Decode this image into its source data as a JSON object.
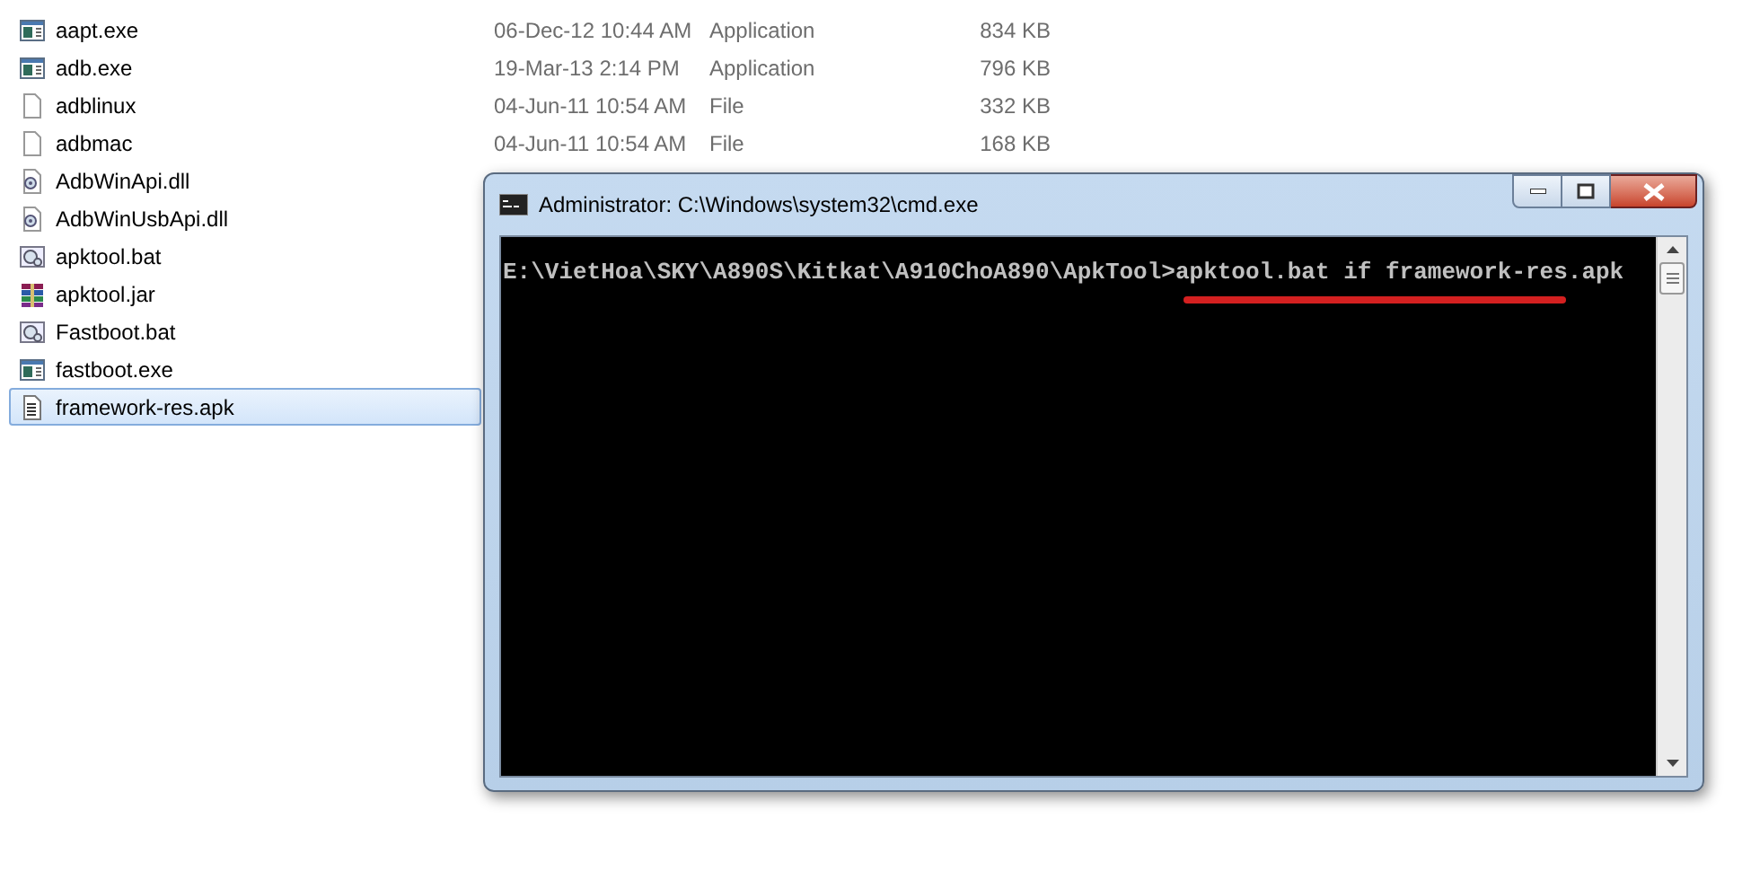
{
  "files": [
    {
      "name": "aapt.exe",
      "kind": "app",
      "selected": false,
      "date": "06-Dec-12 10:44 AM",
      "type": "Application",
      "size": "834 KB"
    },
    {
      "name": "adb.exe",
      "kind": "app",
      "selected": false,
      "date": "19-Mar-13 2:14 PM",
      "type": "Application",
      "size": "796 KB"
    },
    {
      "name": "adblinux",
      "kind": "file",
      "selected": false,
      "date": "04-Jun-11 10:54 AM",
      "type": "File",
      "size": "332 KB"
    },
    {
      "name": "adbmac",
      "kind": "file",
      "selected": false,
      "date": "04-Jun-11 10:54 AM",
      "type": "File",
      "size": "168 KB"
    },
    {
      "name": "AdbWinApi.dll",
      "kind": "dll",
      "selected": false
    },
    {
      "name": "AdbWinUsbApi.dll",
      "kind": "dll",
      "selected": false
    },
    {
      "name": "apktool.bat",
      "kind": "bat",
      "selected": false
    },
    {
      "name": "apktool.jar",
      "kind": "jar",
      "selected": false
    },
    {
      "name": "Fastboot.bat",
      "kind": "bat",
      "selected": false
    },
    {
      "name": "fastboot.exe",
      "kind": "app",
      "selected": false
    },
    {
      "name": "framework-res.apk",
      "kind": "apk",
      "selected": true
    }
  ],
  "console_window": {
    "title": "Administrator: C:\\Windows\\system32\\cmd.exe",
    "prompt": "E:\\VietHoa\\SKY\\A890S\\Kitkat\\A910ChoA890\\ApkTool>",
    "command": "apktool.bat if framework-res.apk"
  }
}
